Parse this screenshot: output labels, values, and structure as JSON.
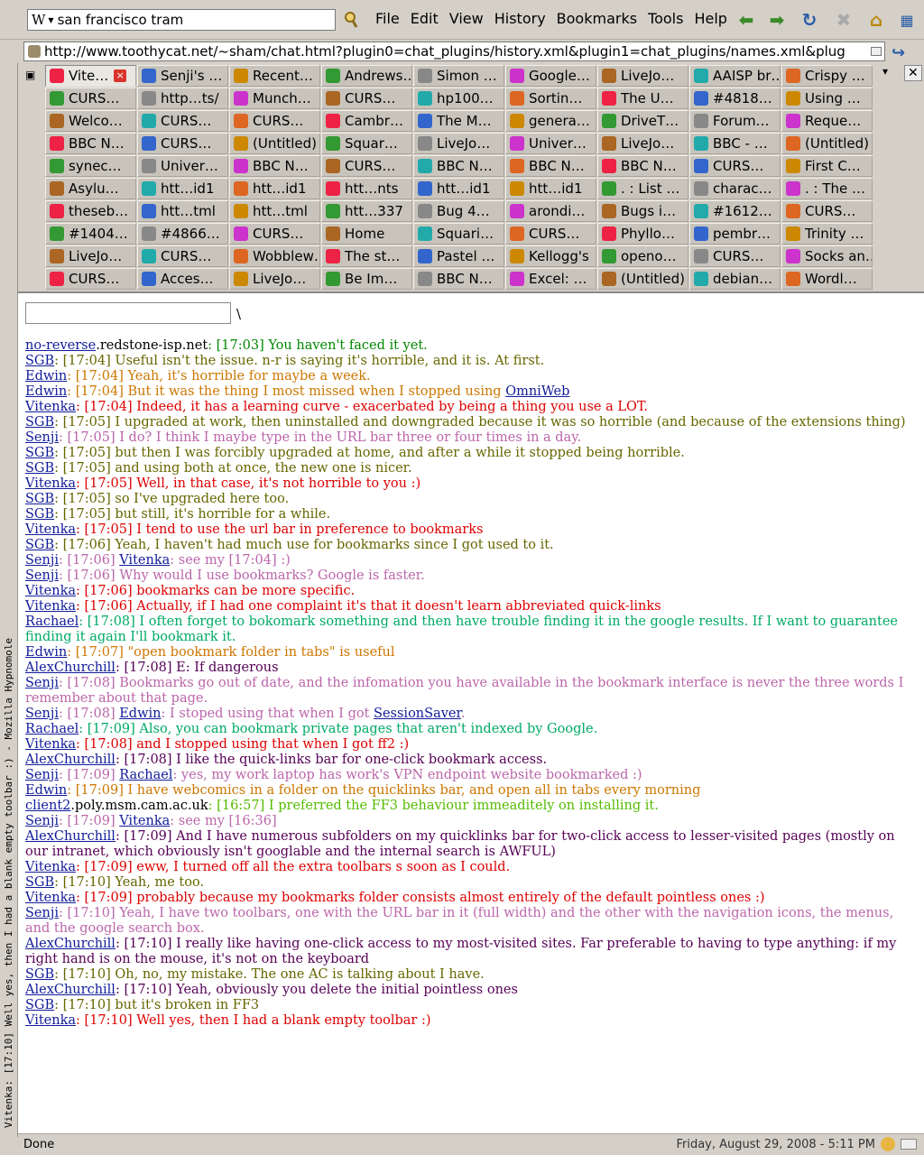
{
  "toolbar": {
    "search_value": "san francisco tram",
    "search_engine_glyph": "W",
    "menus": [
      "File",
      "Edit",
      "View",
      "History",
      "Bookmarks",
      "Tools",
      "Help"
    ]
  },
  "urlbar": {
    "url": "http://www.toothycat.net/~sham/chat.html?plugin0=chat_plugins/history.xml&plugin1=chat_plugins/names.xml&plug"
  },
  "sidebar": {
    "text": "Vitenka: [17:10] Well yes, then I had a blank empty toolbar :) - Mozilla Hypnomole"
  },
  "tabs": [
    [
      "Vite…",
      "Senji's …",
      "Recent…",
      "Andrews…",
      "Simon …",
      "Google…",
      "LiveJo…",
      "AAISP br…",
      "Crispy …"
    ],
    [
      "CURS…",
      "http…ts/",
      "Munch…",
      "CURS…",
      "hp100…",
      "Sortin…",
      "The U…",
      "#4818…",
      "Using …"
    ],
    [
      "Welco…",
      "CURS…",
      "CURS…",
      "Cambr…",
      "The M…",
      "genera…",
      "DriveT…",
      "Forum…",
      "Reque…"
    ],
    [
      "BBC N…",
      "CURS…",
      "(Untitled)",
      "Squar…",
      "LiveJo…",
      "Univer…",
      "LiveJo…",
      "BBC - …",
      "(Untitled)"
    ],
    [
      "synec…",
      "Univer…",
      "BBC N…",
      "CURS…",
      "BBC N…",
      "BBC N…",
      "BBC N…",
      "CURS…",
      "First C…"
    ],
    [
      "Asylu…",
      "htt…id1",
      "htt…id1",
      "htt…nts",
      "htt…id1",
      "htt…id1",
      ". : List …",
      "charac…",
      ". : The …"
    ],
    [
      "theseb…",
      "htt…tml",
      "htt…tml",
      "htt…337",
      "Bug 4…",
      "arondi…",
      "Bugs i…",
      "#1612…",
      "CURS…"
    ],
    [
      "#1404…",
      "#4866…",
      "CURS…",
      "Home",
      "Squari…",
      "CURS…",
      "Phyllo…",
      "pembr…",
      "Trinity …"
    ],
    [
      "LiveJo…",
      "CURS…",
      "Wobblew…",
      "The st…",
      "Pastel …",
      "Kellogg's",
      "openo…",
      "CURS…",
      "Socks an…"
    ],
    [
      "CURS…",
      "Acces…",
      "LiveJo…",
      "Be Im…",
      "BBC N…",
      "Excel: …",
      "(Untitled)",
      "debian…",
      "Wordl…"
    ]
  ],
  "chat": {
    "prompt_suffix": "\\",
    "lines": [
      {
        "nick": "no-reverse",
        "host": ".redstone-isp.net",
        "msg": ": [17:03] You haven't faced it yet.",
        "color": "#008800"
      },
      {
        "nick": "SGB",
        "msg": ": [17:04] Useful isn't the issue. n-r is saying it's horrible, and it is. At first.",
        "color": "#666600"
      },
      {
        "nick": "Edwin",
        "msg": ": [17:04] Yeah, it's horrible for maybe a week.",
        "color": "#cc7700"
      },
      {
        "nick": "Edwin",
        "msg": ": [17:04] But it was the thing I most missed when I stopped using ",
        "link": "OmniWeb",
        "color": "#cc7700"
      },
      {
        "nick": "Vitenka",
        "msg": ": [17:04] Indeed, it has a learning curve - exacerbated by being a thing you use a LOT.",
        "color": "#dd0000"
      },
      {
        "nick": "SGB",
        "msg": ": [17:05] I upgraded at work, then uninstalled and downgraded because it was so horrible (and because of the extensions thing)",
        "color": "#666600"
      },
      {
        "nick": "Senji",
        "msg": ": [17:05] I do? I think I maybe type in the URL bar three or four times in a day.",
        "color": "#bb66aa"
      },
      {
        "nick": "SGB",
        "msg": ": [17:05] but then I was forcibly upgraded at home, and after a while it stopped being horrible.",
        "color": "#666600"
      },
      {
        "nick": "SGB",
        "msg": ": [17:05] and using both at once, the new one is nicer.",
        "color": "#666600"
      },
      {
        "nick": "Vitenka",
        "msg": ": [17:05] Well, in that case, it's not horrible to you :)",
        "color": "#dd0000"
      },
      {
        "nick": "SGB",
        "msg": ": [17:05] so I've upgraded here too.",
        "color": "#666600"
      },
      {
        "nick": "SGB",
        "msg": ": [17:05] but still, it's horrible for a while.",
        "color": "#666600"
      },
      {
        "nick": "Vitenka",
        "msg": ": [17:05] I tend to use the url bar in preference to bookmarks",
        "color": "#dd0000"
      },
      {
        "nick": "SGB",
        "msg": ": [17:06] Yeah, I haven't had much use for bookmarks since I got used to it.",
        "color": "#666600"
      },
      {
        "nick": "Senji",
        "msg": ": [17:06] ",
        "nick2": "Vitenka",
        "msg2": ": see my [17:04] :)",
        "color": "#bb66aa"
      },
      {
        "nick": "Senji",
        "msg": ": [17:06] Why would I use bookmarks? Google is faster.",
        "color": "#bb66aa"
      },
      {
        "nick": "Vitenka",
        "msg": ": [17:06] bookmarks can be more specific.",
        "color": "#dd0000"
      },
      {
        "nick": "Vitenka",
        "msg": ": [17:06] Actually, if I had one complaint it's that it doesn't learn abbreviated quick-links",
        "color": "#dd0000"
      },
      {
        "nick": "Rachael",
        "msg": ": [17:08] I often forget to bokomark something and then have trouble finding it in the google results. If I want to guarantee finding it again I'll bookmark it.",
        "color": "#00aa66"
      },
      {
        "nick": "Edwin",
        "msg": ": [17:07] \"open bookmark folder in tabs\" is useful",
        "color": "#cc7700"
      },
      {
        "nick": "AlexChurchill",
        "msg": ": [17:08] E: If dangerous",
        "color": "#550055"
      },
      {
        "nick": "Senji",
        "msg": ": [17:08] Bookmarks go out of date, and the infomation you have available in the bookmark interface is never the three words I remember about that page.",
        "color": "#bb66aa"
      },
      {
        "nick": "Senji",
        "msg": ": [17:08] ",
        "nick2": "Edwin",
        "msg2": ": I stoped using that when I got ",
        "link": "SessionSaver",
        "tail": ".",
        "color": "#bb66aa"
      },
      {
        "nick": "Rachael",
        "msg": ": [17:09] Also, you can bookmark private pages that aren't indexed by Google.",
        "color": "#00aa66"
      },
      {
        "nick": "Vitenka",
        "msg": ": [17:08] and I stopped using that when I got ff2 :)",
        "color": "#dd0000"
      },
      {
        "nick": "AlexChurchill",
        "msg": ": [17:08] I like the quick-links bar for one-click bookmark access.",
        "color": "#550055"
      },
      {
        "nick": "Senji",
        "msg": ": [17:09] ",
        "nick2": "Rachael",
        "msg2": ": yes, my work laptop has work's VPN endpoint website bookmarked :)",
        "color": "#bb66aa"
      },
      {
        "nick": "Edwin",
        "msg": ": [17:09] I have webcomics in a folder on the quicklinks bar, and open all in tabs every morning",
        "color": "#cc7700"
      },
      {
        "nick": "client2",
        "host": ".poly.msm.cam.ac.uk",
        "msg": ": [16:57] I preferred the FF3 behaviour immeaditely on installing it.",
        "color": "#55bb00"
      },
      {
        "nick": "Senji",
        "msg": ": [17:09] ",
        "nick2": "Vitenka",
        "msg2": ": see my [16:36]",
        "color": "#bb66aa"
      },
      {
        "nick": "AlexChurchill",
        "msg": ": [17:09] And I have numerous subfolders on my quicklinks bar for two-click access to lesser-visited pages (mostly on our intranet, which obviously isn't googlable and the internal search is AWFUL)",
        "color": "#550055"
      },
      {
        "nick": "Vitenka",
        "msg": ": [17:09] eww, I turned off all the extra toolbars s soon as I could.",
        "color": "#dd0000"
      },
      {
        "nick": "SGB",
        "msg": ": [17:10] Yeah, me too.",
        "color": "#666600"
      },
      {
        "nick": "Vitenka",
        "msg": ": [17:09] probably because my bookmarks folder consists almost entirely of the default pointless ones :)",
        "color": "#dd0000"
      },
      {
        "nick": "Senji",
        "msg": ": [17:10] Yeah, I have two toolbars, one with the URL bar in it (full width) and the other with the navigation icons, the menus, and the google search box.",
        "color": "#bb66aa"
      },
      {
        "nick": "AlexChurchill",
        "msg": ": [17:10] I really like having one-click access to my most-visited sites. Far preferable to having to type anything: if my right hand is on the mouse, it's not on the keyboard",
        "color": "#550055"
      },
      {
        "nick": "SGB",
        "msg": ": [17:10] Oh, no, my mistake. The one AC is talking about I have.",
        "color": "#666600"
      },
      {
        "nick": "AlexChurchill",
        "msg": ": [17:10] Yeah, obviously you delete the initial pointless ones",
        "color": "#550055"
      },
      {
        "nick": "SGB",
        "msg": ": [17:10] but it's broken in FF3",
        "color": "#666600"
      },
      {
        "nick": "Vitenka",
        "msg": ": [17:10] Well yes, then I had a blank empty toolbar :)",
        "color": "#dd0000"
      }
    ]
  },
  "status": {
    "left": "Done",
    "right": "Friday, August 29, 2008 - 5:11 PM"
  },
  "colors": {
    "accent": "#2a5ca8",
    "nick_link": "#111c99"
  }
}
